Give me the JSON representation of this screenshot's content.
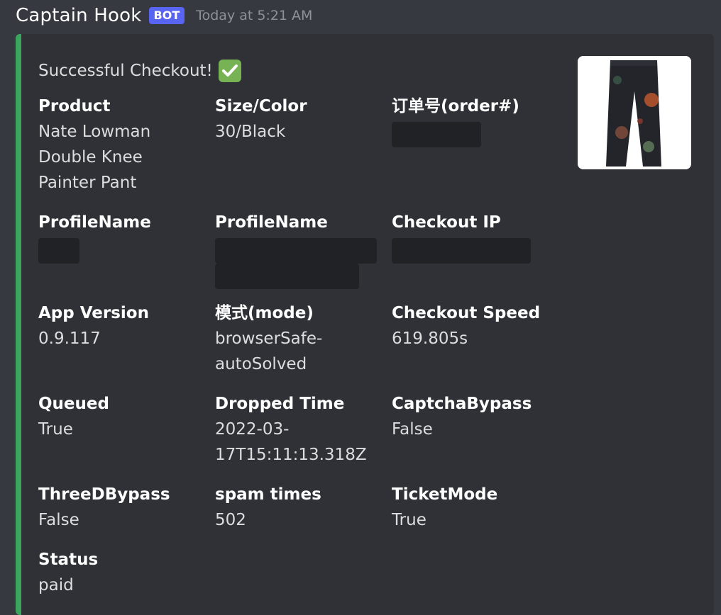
{
  "message": {
    "author": "Captain Hook",
    "badge": "BOT",
    "timestamp": "Today at 5:21 AM"
  },
  "embed": {
    "accent_color": "#3ba55d",
    "description": "Successful Checkout!",
    "description_icon": "white-check-mark-icon",
    "fields": [
      {
        "name": "Product",
        "value_lines": [
          "Nate Lowman",
          "Double Knee",
          "Painter Pant"
        ]
      },
      {
        "name": "Size/Color",
        "value_lines": [
          "30/Black"
        ]
      },
      {
        "name": "订单号(order#)",
        "value_lines": [],
        "redacted": true
      },
      {
        "name": "ProfileName",
        "value_lines": [],
        "redacted": true
      },
      {
        "name": "ProfileName",
        "value_lines": [],
        "redacted": true
      },
      {
        "name": "Checkout IP",
        "value_lines": [],
        "redacted": true
      },
      {
        "name": "App Version",
        "value_lines": [
          "0.9.117"
        ]
      },
      {
        "name": "模式(mode)",
        "value_lines": [
          "browserSafe-",
          "autoSolved"
        ]
      },
      {
        "name": "Checkout Speed",
        "value_lines": [
          "619.805s"
        ]
      },
      {
        "name": "Queued",
        "value_lines": [
          "True"
        ]
      },
      {
        "name": "Dropped Time",
        "value_lines": [
          "2022-03-",
          "17T15:11:13.318Z"
        ]
      },
      {
        "name": "CaptchaBypass",
        "value_lines": [
          "False"
        ]
      },
      {
        "name": "ThreeDBypass",
        "value_lines": [
          "False"
        ]
      },
      {
        "name": "spam times",
        "value_lines": [
          "502"
        ]
      },
      {
        "name": "TicketMode",
        "value_lines": [
          "True"
        ]
      },
      {
        "name": "Status",
        "value_lines": [
          "paid"
        ]
      }
    ]
  }
}
